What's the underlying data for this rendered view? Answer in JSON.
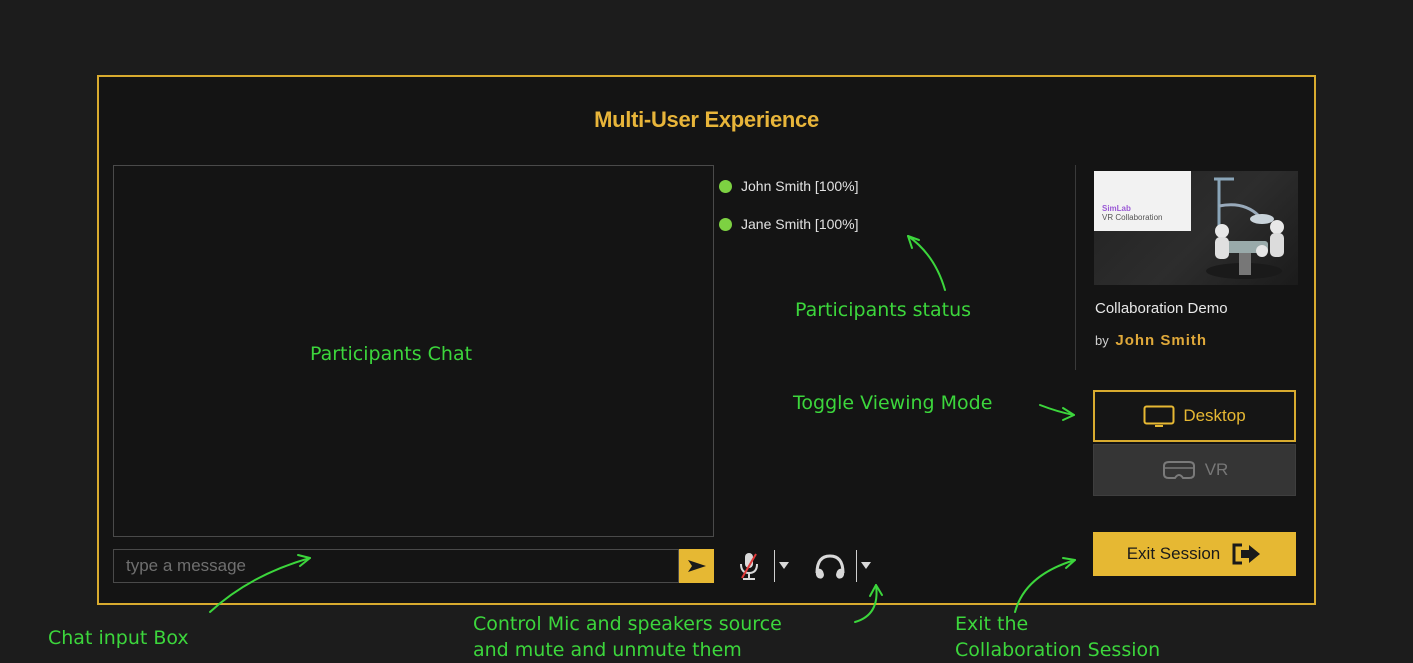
{
  "dialog": {
    "title": "Multi-User Experience"
  },
  "chat": {
    "input_placeholder": "type a message",
    "send_icon": "send-arrow-icon"
  },
  "participants": [
    {
      "name": "John Smith [100%]",
      "status_color": "#7dd142"
    },
    {
      "name": "Jane Smith  [100%]",
      "status_color": "#7dd142"
    }
  ],
  "audio": {
    "mic_icon": "microphone-muted-icon",
    "headphones_icon": "headphones-icon",
    "dropdown_icon": "caret-down-icon"
  },
  "project": {
    "thumbnail_brand": "SimLab",
    "thumbnail_subtitle": "VR Collaboration",
    "name": "Collaboration Demo",
    "by_label": "by",
    "author": "John Smith"
  },
  "view_modes": {
    "desktop_label": "Desktop",
    "vr_label": "VR",
    "selected": "Desktop"
  },
  "exit_button": {
    "label": "Exit Session",
    "icon": "exit-door-arrow-icon"
  },
  "annotations": {
    "participants_chat": "Participants Chat",
    "participants_status": "Participants status",
    "toggle_viewing_mode": "Toggle Viewing Mode",
    "chat_input_box": "Chat input Box",
    "control_mic_line1": "Control Mic and speakers source",
    "control_mic_line2": "and mute and unmute them",
    "exit_line1": "Exit the",
    "exit_line2": "Collaboration Session"
  },
  "colors": {
    "accent": "#e6b833",
    "background": "#1c1c1c",
    "panel": "#141414",
    "annotation": "#3cd63c",
    "online": "#7dd142"
  }
}
